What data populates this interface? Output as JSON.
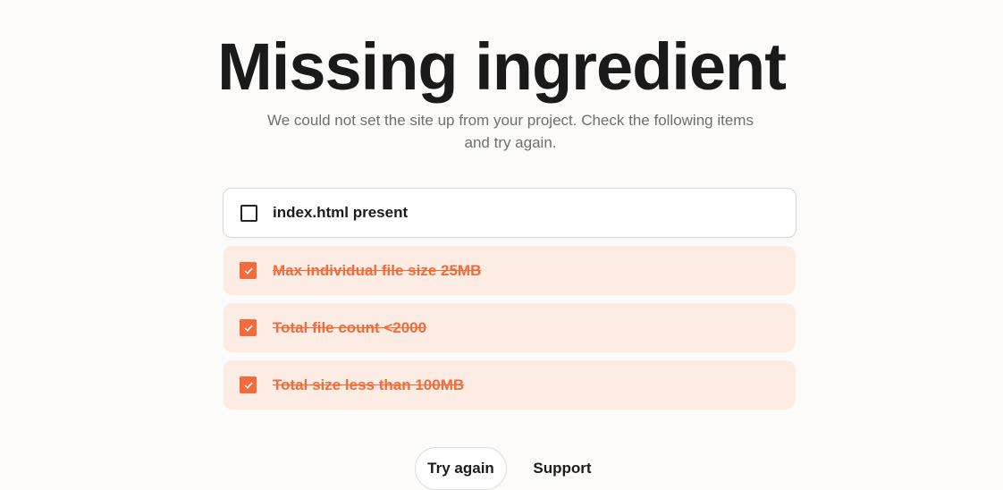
{
  "page": {
    "title": "Missing ingredient",
    "subtitle": "We could not set the site up from your project. Check the following items and try again."
  },
  "checklist": {
    "items": [
      {
        "label": "index.html present",
        "checked": false
      },
      {
        "label": "Max individual file size 25MB",
        "checked": true
      },
      {
        "label": "Total file count <2000",
        "checked": true
      },
      {
        "label": "Total size less than 100MB",
        "checked": true
      }
    ]
  },
  "actions": {
    "try_again_label": "Try again",
    "support_label": "Support"
  },
  "colors": {
    "accent": "#f26b3a",
    "checked_row_bg": "#fdece4",
    "text": "#1c1c1c",
    "muted": "#6f6f6f"
  },
  "icons": {
    "checked": "checkmark-icon",
    "unchecked": "empty-checkbox-icon"
  }
}
